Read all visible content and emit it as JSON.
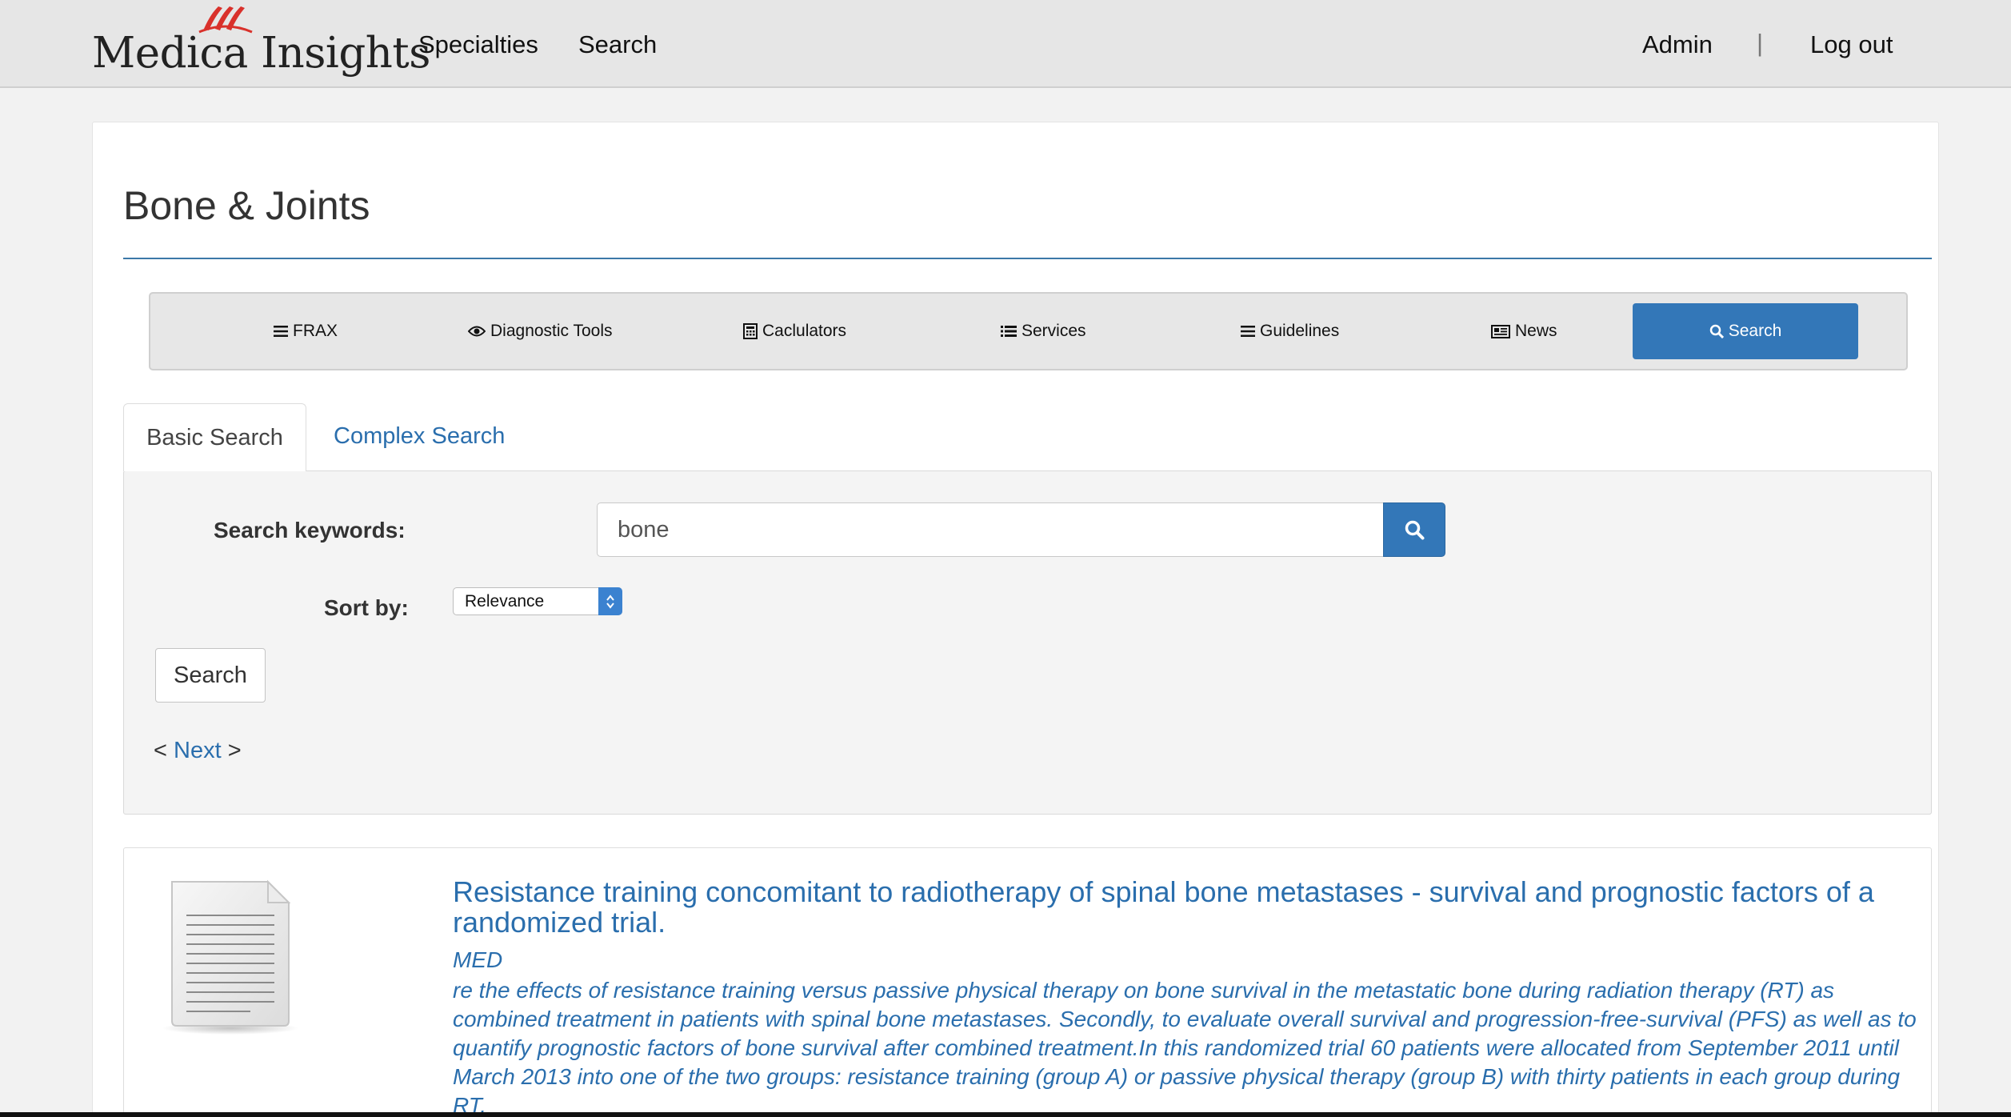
{
  "header": {
    "logo_text": "Medica Insights",
    "nav": [
      "Specialties",
      "Search"
    ],
    "admin_label": "Admin",
    "separator": "|",
    "logout_label": "Log out"
  },
  "page": {
    "title": "Bone & Joints"
  },
  "subnav": {
    "items": [
      {
        "label": "FRAX",
        "icon": "list-icon"
      },
      {
        "label": "Diagnostic Tools",
        "icon": "eye-icon"
      },
      {
        "label": "Caclulators",
        "icon": "calculator-icon"
      },
      {
        "label": "Services",
        "icon": "list-bullets-icon"
      },
      {
        "label": "Guidelines",
        "icon": "list-icon"
      },
      {
        "label": "News",
        "icon": "newspaper-icon"
      },
      {
        "label": "Search",
        "icon": "search-icon",
        "active": true
      }
    ],
    "active_color": "#3377b8"
  },
  "tabs": {
    "basic": "Basic Search",
    "complex": "Complex Search"
  },
  "search_form": {
    "keywords_label": "Search keywords:",
    "keywords_value": "bone",
    "sort_label": "Sort by:",
    "sort_value": "Relevance",
    "submit_label": "Search",
    "pager_prev": "<",
    "pager_next_label": "Next",
    "pager_next_symbol": ">"
  },
  "result": {
    "title": "Resistance training concomitant to radiotherapy of spinal bone metastases - survival and prognostic factors of a randomized trial.",
    "source": "MED",
    "abstract": "re the effects of resistance training versus passive physical therapy on bone survival in the metastatic bone during radiation therapy (RT) as combined treatment in patients with spinal bone metastases. Secondly, to evaluate overall survival and progression-free-survival (PFS) as well as to quantify prognostic factors of bone survival after combined treatment.In this randomized trial 60 patients were allocated from September 2011 until March 2013 into one of the two groups: resistance training (group A) or passive physical therapy (group B) with thirty patients in each group during RT."
  },
  "colors": {
    "link": "#2a6ead",
    "primary": "#3377b8",
    "logo_mark": "#d9312b"
  }
}
